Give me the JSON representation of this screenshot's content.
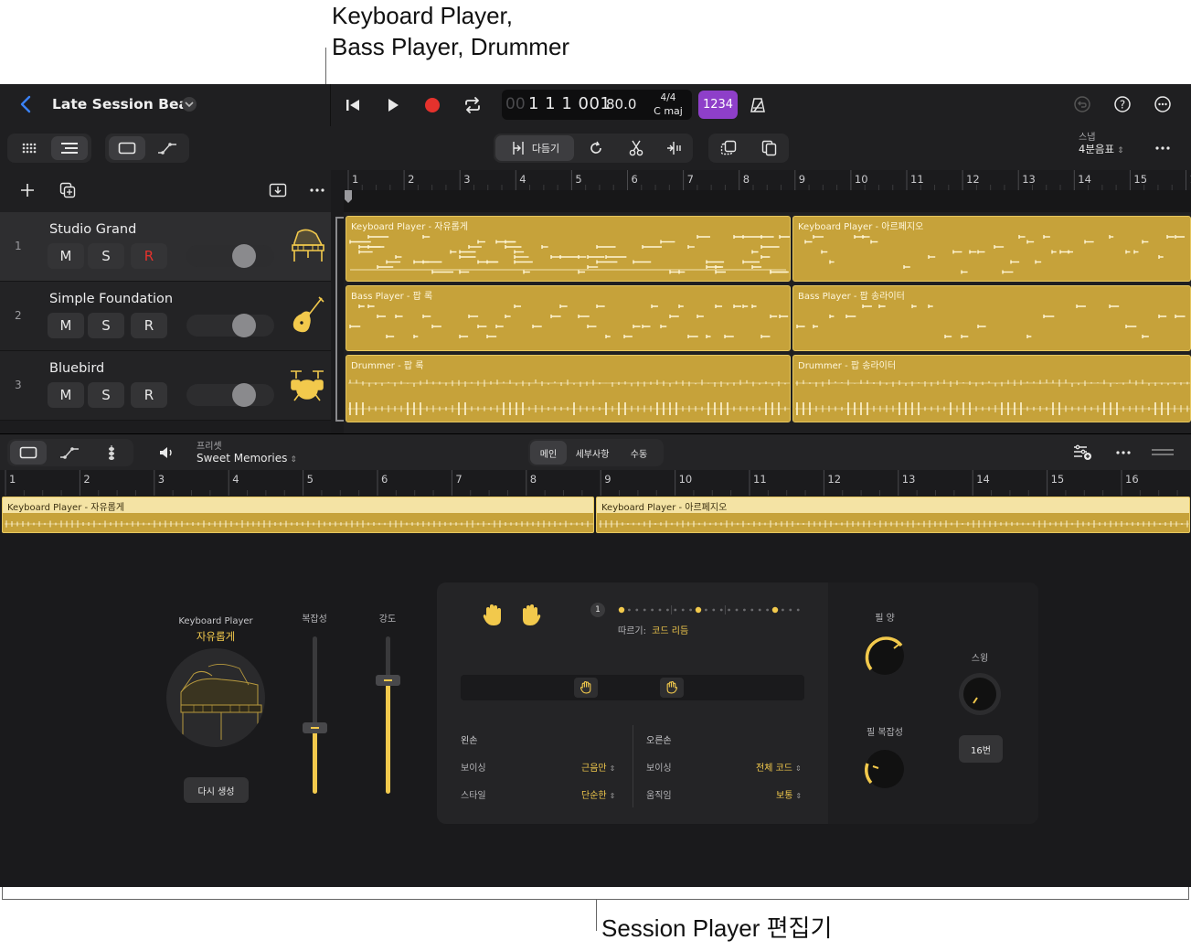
{
  "callouts": {
    "top_line1": "Keyboard Player,",
    "top_line2": "Bass Player, Drummer",
    "bottom": "Session Player 편집기"
  },
  "header": {
    "project_title": "Late Session Beat",
    "lcd": {
      "position": "1 1 1 001",
      "position_dim": "00",
      "tempo": "80.0",
      "signature": "4/4",
      "key": "C maj"
    },
    "count_in_label": "1234"
  },
  "toolbar": {
    "tool_label": "다듬기",
    "snap_label": "스냅",
    "snap_value": "4분음표"
  },
  "tracks": [
    {
      "number": "1",
      "name": "Studio Grand",
      "mute": "M",
      "solo": "S",
      "record": "R",
      "icon": "piano-icon",
      "selected": true,
      "record_armed": true
    },
    {
      "number": "2",
      "name": "Simple Foundation",
      "mute": "M",
      "solo": "S",
      "record": "R",
      "icon": "guitar-icon",
      "selected": false,
      "record_armed": false
    },
    {
      "number": "3",
      "name": "Bluebird",
      "mute": "M",
      "solo": "S",
      "record": "R",
      "icon": "drums-icon",
      "selected": false,
      "record_armed": false
    }
  ],
  "ruler": {
    "bars": [
      "1",
      "2",
      "3",
      "4",
      "5",
      "6",
      "7",
      "8",
      "9",
      "10",
      "11",
      "12",
      "13",
      "14",
      "15",
      "1"
    ]
  },
  "regions": {
    "keys_a": "Keyboard Player - 자유롭게",
    "keys_b": "Keyboard Player - 아르페지오",
    "bass_a": "Bass Player - 팝 록",
    "bass_b": "Bass Player - 팝 송라이터",
    "drum_a": "Drummer - 팝 록",
    "drum_b": "Drummer - 팝 송라이터"
  },
  "editor": {
    "preset_label": "프리셋",
    "preset_value": "Sweet Memories",
    "tabs": [
      "메인",
      "세부사항",
      "수동"
    ],
    "active_tab": "메인",
    "ruler_bars": [
      "1",
      "2",
      "3",
      "4",
      "5",
      "6",
      "7",
      "8",
      "9",
      "10",
      "11",
      "12",
      "13",
      "14",
      "15",
      "16"
    ],
    "region_a": "Keyboard Player - 자유롭게",
    "region_b": "Keyboard Player - 아르페지오",
    "player_name": "Keyboard Player",
    "player_style": "자유롭게",
    "complexity_label": "복잡성",
    "intensity_label": "강도",
    "complexity_level": 0.42,
    "intensity_level": 0.72,
    "regenerate_label": "다시 생성",
    "follow_number": "1",
    "follow_label": "따르기:",
    "follow_value": "코드 리듬",
    "left_hand": {
      "title": "왼손",
      "voicing_label": "보이싱",
      "voicing_value": "근음만",
      "style_label": "스타일",
      "style_value": "단순한"
    },
    "right_hand": {
      "title": "오른손",
      "voicing_label": "보이싱",
      "voicing_value": "전체 코드",
      "movement_label": "움직임",
      "movement_value": "보통"
    },
    "fill_amount_label": "필 양",
    "fill_complexity_label": "필 복잡성",
    "swing_label": "스윙",
    "swing_value": "16번"
  },
  "colors": {
    "accent_yellow": "#f2c94c",
    "region_gold": "#c6a23a",
    "record_red": "#e5322d",
    "count_in_purple": "#8e3fc9",
    "back_blue": "#3a82f7"
  }
}
